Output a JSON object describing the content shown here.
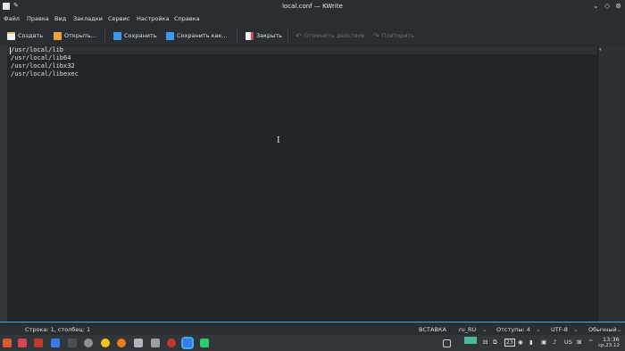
{
  "window": {
    "title": "local.conf — KWrite"
  },
  "menu": [
    "Файл",
    "Правка",
    "Вид",
    "Закладки",
    "Сервис",
    "Настройка",
    "Справка"
  ],
  "toolbar": {
    "new_label": "Создать",
    "open_label": "Открыть...",
    "save_label": "Сохранить",
    "save_as_label": "Сохранить как...",
    "close_label": "Закрыть",
    "undo_label": "Отменить действие",
    "redo_label": "Повторить"
  },
  "editor": {
    "lines": [
      "/usr/local/lib",
      "/usr/local/lib64",
      "/usr/local/libx32",
      "/usr/local/libexec"
    ]
  },
  "status": {
    "position": "Строка: 1, столбец: 1",
    "mode": "ВСТАВКА",
    "dictionary": "ru_RU",
    "indent": "Отступы: 4",
    "encoding": "UTF-8",
    "highlight": "Обычный"
  },
  "tray": {
    "layout": "US",
    "time": "13:36",
    "date": "ср,23.12",
    "notifications": "23"
  },
  "colors": {
    "accent": "#3daee9",
    "background": "#232629",
    "panel": "#2a2e32"
  }
}
